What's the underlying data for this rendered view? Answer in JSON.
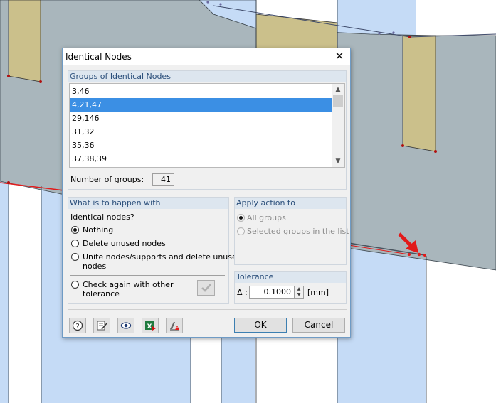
{
  "dialog": {
    "title": "Identical Nodes",
    "groups_section": {
      "header": "Groups of Identical Nodes",
      "items": [
        "3,46",
        "4,21,47",
        "29,146",
        "31,32",
        "35,36",
        "37,38,39"
      ],
      "selected_item": "4,21,47",
      "count_label": "Number of groups:",
      "count_value": "41"
    },
    "action_section": {
      "header": "What is to happen with",
      "question": "Identical nodes?",
      "options": [
        "Nothing",
        "Delete unused nodes",
        "Unite nodes/supports and delete unused",
        "nodes"
      ],
      "selected_option": "Nothing",
      "check_again_line1": "Check again with other",
      "check_again_line2": "tolerance"
    },
    "apply_section": {
      "header": "Apply action to",
      "options": [
        "All groups",
        "Selected groups in the list"
      ]
    },
    "tolerance_section": {
      "header": "Tolerance",
      "symbol": "Δ :",
      "value": "0.1000",
      "unit": "[mm]"
    },
    "buttons": {
      "ok": "OK",
      "cancel": "Cancel"
    },
    "toolbar_icons": [
      "help-icon",
      "edit-notes-icon",
      "view-eye-icon",
      "excel-export-icon",
      "clear-selection-icon"
    ]
  },
  "colors": {
    "selection": "#3b8fe4",
    "section_header": "#dde6ef",
    "background_slab": "#a9b6bc",
    "background_wall": "#c5dbf6",
    "background_column": "#cbc08b",
    "marker_red": "#e21a1a"
  }
}
